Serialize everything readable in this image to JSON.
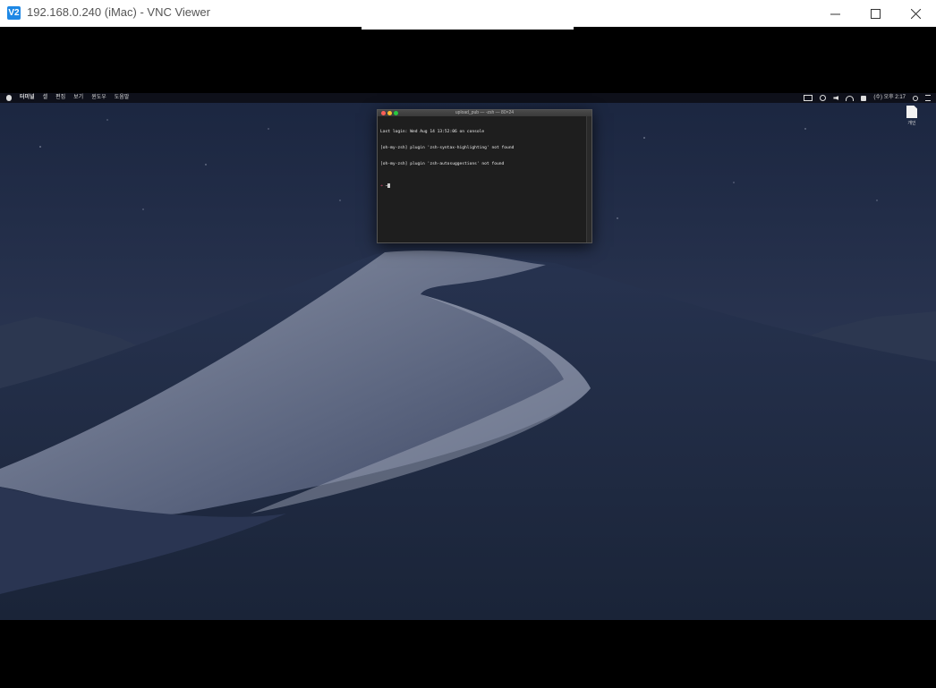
{
  "window": {
    "title": "192.168.0.240 (iMac) - VNC Viewer",
    "logo_text": "V2"
  },
  "mac_menubar": {
    "left_items": [
      "터미널",
      "셸",
      "편집",
      "보기",
      "윈도우",
      "도움말"
    ],
    "right_items": [
      "(수) 오후 2:17"
    ]
  },
  "desktop_icon": {
    "label": "개인"
  },
  "terminal": {
    "title": "upload_pub — -zsh — 80×24",
    "lines": [
      "Last login: Wed Aug 14 13:52:06 on console",
      "[oh-my-zsh] plugin 'zsh-syntax-highlighting' not found",
      "[oh-my-zsh] plugin 'zsh-autosuggestions' not found"
    ],
    "prompt_symbol": "➜",
    "prompt_dir": "~"
  },
  "colors": {
    "accent": "#1e88e5",
    "prompt": "#e84a77"
  }
}
